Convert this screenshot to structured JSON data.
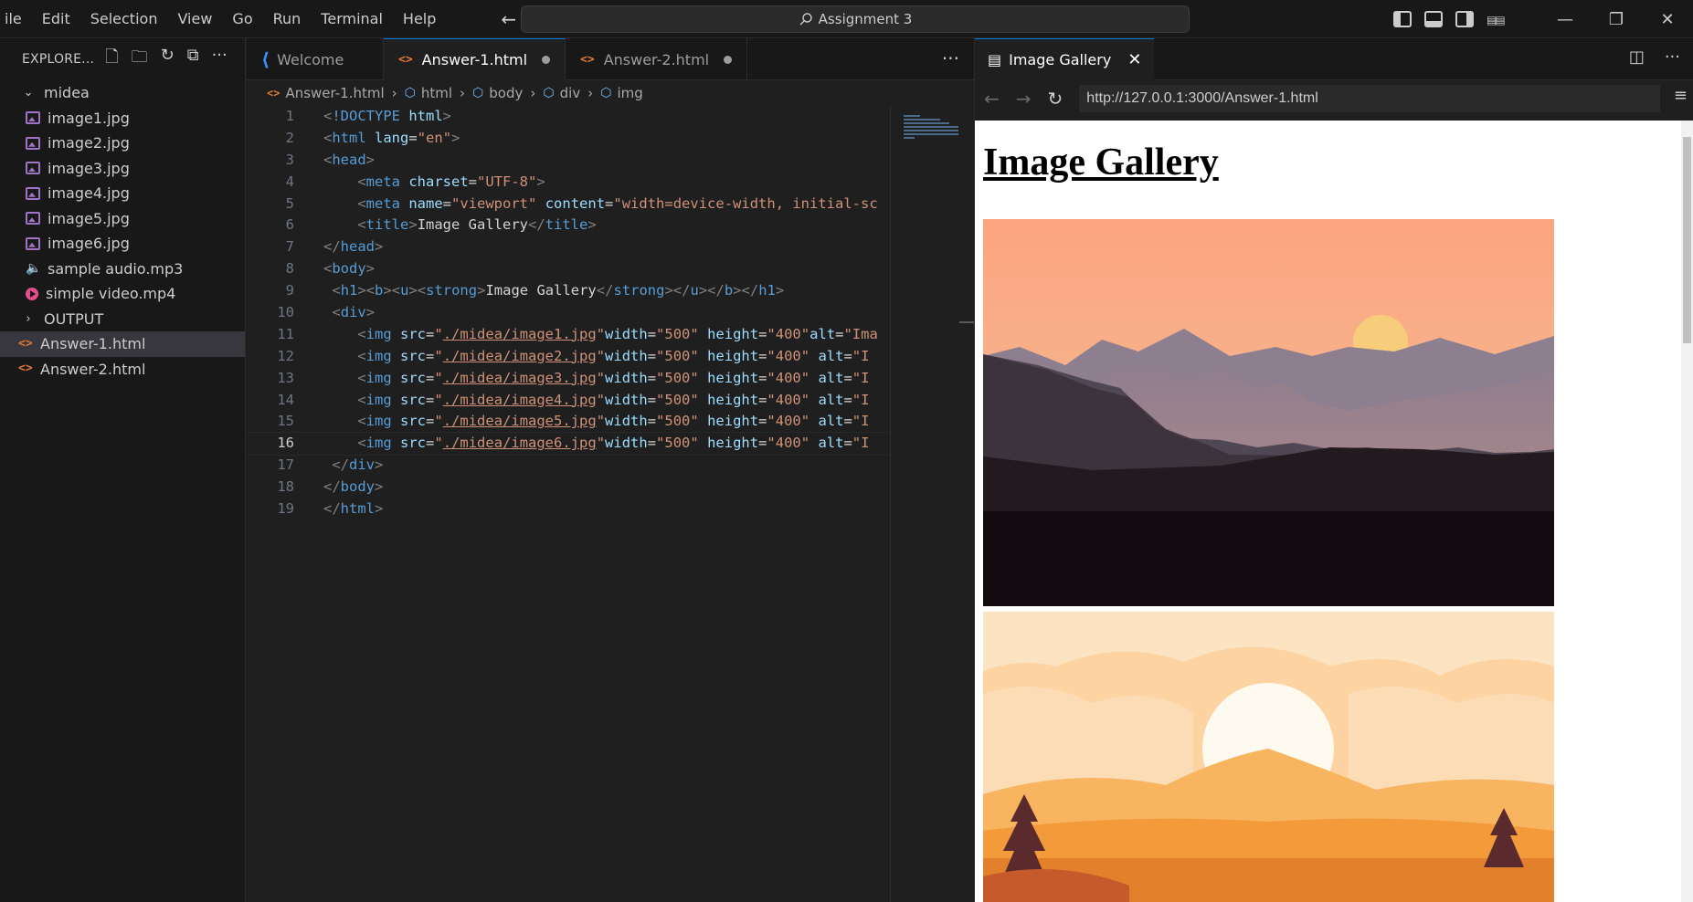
{
  "menu": [
    "ile",
    "Edit",
    "Selection",
    "View",
    "Go",
    "Run",
    "Terminal",
    "Help"
  ],
  "command_center": {
    "label": "Assignment 3"
  },
  "explorer": {
    "title": "EXPLORE...",
    "folder": "midea",
    "files": [
      "image1.jpg",
      "image2.jpg",
      "image3.jpg",
      "image4.jpg",
      "image5.jpg",
      "image6.jpg",
      "sample audio.mp3",
      "simple video.mp4"
    ],
    "output_folder": "OUTPUT",
    "root_files": [
      "Answer-1.html",
      "Answer-2.html"
    ]
  },
  "tabs": [
    {
      "label": "Welcome"
    },
    {
      "label": "Answer-1.html"
    },
    {
      "label": "Answer-2.html"
    }
  ],
  "breadcrumb": [
    "Answer-1.html",
    "html",
    "body",
    "div",
    "img"
  ],
  "code_lines": [
    "<!DOCTYPE html>",
    "<html lang=\"en\">",
    "<head>",
    "    <meta charset=\"UTF-8\">",
    "    <meta name=\"viewport\" content=\"width=device-width, initial-sc",
    "    <title>Image Gallery</title>",
    "</head>",
    "<body>",
    " <h1><b><u><strong>Image Gallery</strong></u></b></h1>",
    " <div>",
    "    <img src=\"./midea/image1.jpg\"width=\"500\" height=\"400\"alt=\"Ima",
    "    <img src=\"./midea/image2.jpg\"width=\"500\" height=\"400\" alt=\"I",
    "    <img src=\"./midea/image3.jpg\"width=\"500\" height=\"400\" alt=\"I",
    "    <img src=\"./midea/image4.jpg\"width=\"500\" height=\"400\" alt=\"I",
    "    <img src=\"./midea/image5.jpg\"width=\"500\" height=\"400\" alt=\"I",
    "    <img src=\"./midea/image6.jpg\"width=\"500\" height=\"400\" alt=\"I",
    " </div>",
    "</body>",
    "</html>"
  ],
  "current_line": 16,
  "preview": {
    "tab_title": "Image Gallery",
    "url": "http://127.0.0.1:3000/Answer-1.html",
    "page_heading": "Image Gallery"
  },
  "icons": {
    "back": "arrow-left-icon",
    "forward": "arrow-right-icon",
    "reload": "refresh-icon",
    "search": "search-icon",
    "close": "close-icon",
    "more": "ellipsis-icon"
  }
}
